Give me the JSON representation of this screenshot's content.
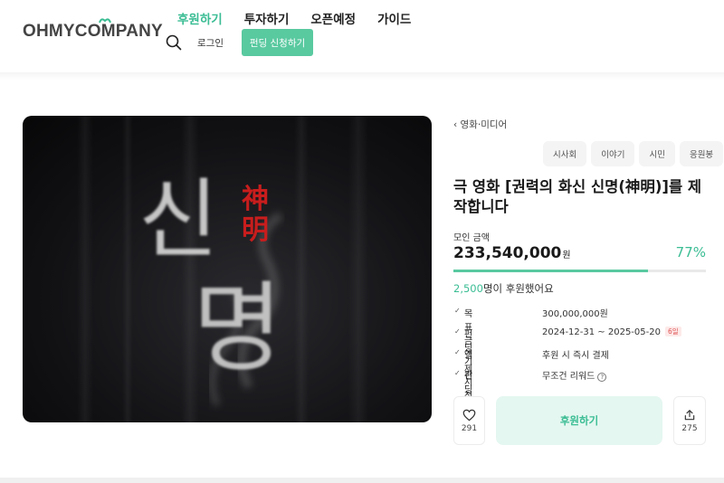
{
  "header": {
    "logo_text": "OHMYCOMPANY",
    "nav": [
      "후원하기",
      "투자하기",
      "오픈예정",
      "가이드"
    ],
    "active_nav": "후원하기",
    "login_label": "로그인",
    "apply_label": "펀딩 신청하기"
  },
  "project": {
    "category": "영화·미디어",
    "tags": [
      "시사회",
      "이야기",
      "시민",
      "응원봉"
    ],
    "title": "극 영화 [권력의 화신 신명(神明)]를 제작합니다",
    "poster": {
      "hangul_title": "신명",
      "hanja_title": "神明"
    },
    "raised_label": "모인 금액",
    "raised_amount": "233,540,000",
    "raised_unit": "원",
    "percent_text": "77%",
    "progress_fraction": 0.77,
    "supporters_count": "2,500",
    "supporters_suffix": "명이 후원했어요",
    "info": [
      {
        "key": "목표 금액",
        "value": "300,000,000원"
      },
      {
        "key": "펀딩 기간",
        "value": "2024-12-31 ~ 2025-05-20",
        "badge": "6일"
      },
      {
        "key": "결제 시점",
        "value": "후원 시 즉시 결제"
      },
      {
        "key": "펀딩 방식",
        "value": "무조건 리워드",
        "help": "?"
      }
    ],
    "like_count": "291",
    "support_label": "후원하기",
    "share_count": "275"
  },
  "colors": {
    "accent": "#3bbd94",
    "accent_light": "#e4f7f0",
    "badge_red": "#e05555"
  }
}
